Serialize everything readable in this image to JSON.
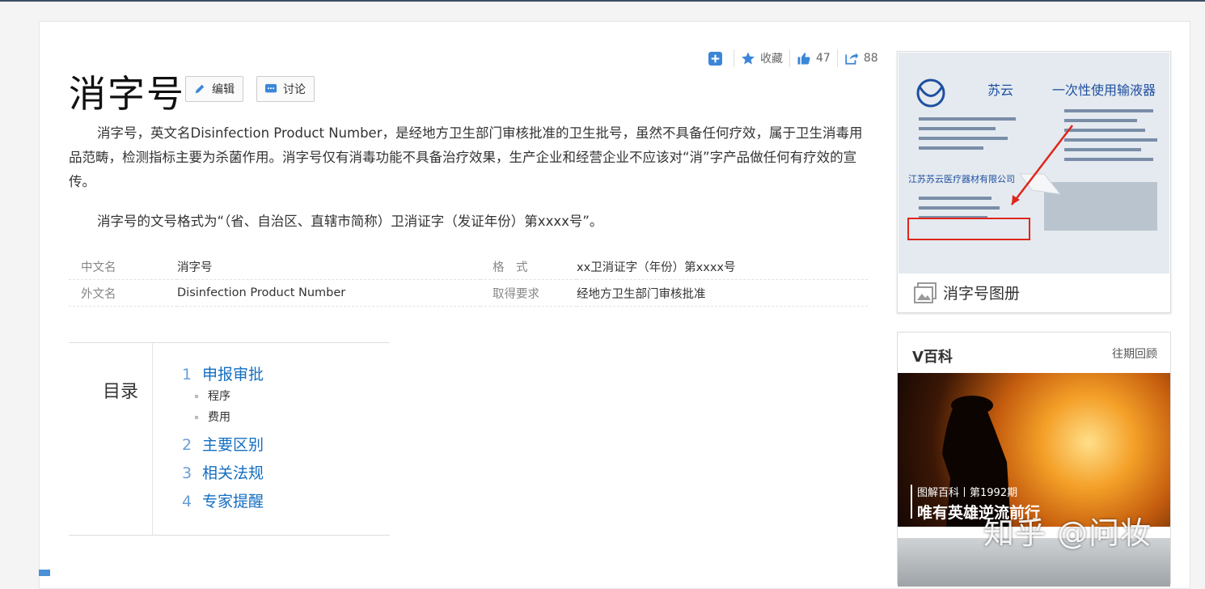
{
  "toolbar": {
    "favorite_label": "收藏",
    "like_count": "47",
    "share_count": "88"
  },
  "entry": {
    "title": "消字号",
    "edit_label": "编辑",
    "discuss_label": "讨论",
    "paragraph1": "消字号，英文名Disinfection Product Number，是经地方卫生部门审核批准的卫生批号，虽然不具备任何疗效，属于卫生消毒用品范畴，检测指标主要为杀菌作用。消字号仅有消毒功能不具备治疗效果，生产企业和经营企业不应该对“消”字产品做任何有疗效的宣传。",
    "paragraph2": "消字号的文号格式为“（省、自治区、直辖市简称）卫消证字（发证年份）第xxxx号”。"
  },
  "info": [
    {
      "k1": "中文名",
      "v1": "消字号",
      "k2": "格　式",
      "v2": "xx卫消证字（年份）第xxxx号"
    },
    {
      "k1": "外文名",
      "v1": "Disinfection Product Number",
      "k2": "取得要求",
      "v2": "经地方卫生部门审核批准"
    }
  ],
  "toc": {
    "heading": "目录",
    "items": [
      {
        "num": "1",
        "label": "申报审批"
      },
      {
        "label": "程序"
      },
      {
        "label": "费用"
      },
      {
        "num": "2",
        "label": "主要区别"
      },
      {
        "num": "3",
        "label": "相关法规"
      },
      {
        "num": "4",
        "label": "专家提醒"
      }
    ]
  },
  "album": {
    "caption": "消字号图册",
    "photo_texts": [
      "苏云",
      "一次性使用输液器",
      "江苏苏云医疗器材有限公司"
    ]
  },
  "vbaike": {
    "heading": "V百科",
    "more": "往期回顾",
    "tag": "图解百科丨第1992期",
    "headline": "唯有英雄逆流前行"
  },
  "watermark": "知乎 @问妆",
  "colors": {
    "accent": "#136ec2",
    "topbar": "#3d4d66"
  }
}
